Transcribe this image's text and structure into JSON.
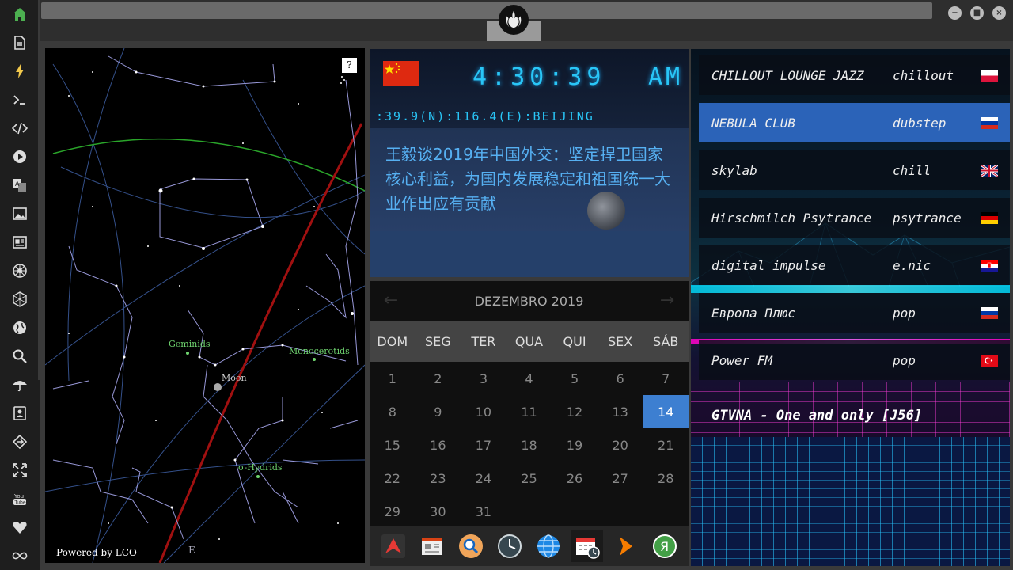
{
  "rail": {
    "items": [
      {
        "icon": "home-icon",
        "color": "#4caf50"
      },
      {
        "icon": "document-icon"
      },
      {
        "icon": "lightning-icon",
        "color": "#f2c94c"
      },
      {
        "icon": "terminal-icon"
      },
      {
        "icon": "code-icon"
      },
      {
        "icon": "play-icon"
      },
      {
        "icon": "translate-icon"
      },
      {
        "icon": "image-icon"
      },
      {
        "icon": "newspaper-icon"
      },
      {
        "icon": "rebel-icon"
      },
      {
        "icon": "hexagon-icon"
      },
      {
        "icon": "globe-icon"
      },
      {
        "icon": "search-icon"
      },
      {
        "icon": "umbrella-icon"
      },
      {
        "icon": "contact-icon"
      },
      {
        "icon": "swap-icon"
      },
      {
        "icon": "expand-icon"
      },
      {
        "icon": "youtube-icon",
        "label": "You Tube"
      },
      {
        "icon": "heart-icon"
      },
      {
        "icon": "infinity-icon"
      }
    ]
  },
  "topbar": {
    "emblem": "rebel-alliance-icon",
    "window_controls": [
      "minimize",
      "maximize",
      "close"
    ]
  },
  "starmap": {
    "help_label": "?",
    "powered_by": "Powered by LCO",
    "compass": "E",
    "labels": {
      "geminids": "Geminids",
      "monocerotids": "Monocerotids",
      "moon": "Moon",
      "hydrids": "σ-Hydrids"
    }
  },
  "clock": {
    "flag": "china-flag",
    "time": "4:30:39",
    "ampm": "AM",
    "coords": ":39.9(N):116.4(E):BEIJING",
    "headline": "王毅谈2019年中国外交：坚定捍卫国家核心利益，为国内发展稳定和祖国统一大业作出应有贡献"
  },
  "calendar": {
    "month_title": "DEZEMBRO 2019",
    "prev": "←",
    "next": "→",
    "weekdays": [
      "DOM",
      "SEG",
      "TER",
      "QUA",
      "QUI",
      "SEX",
      "SÁB"
    ],
    "days": [
      "1",
      "2",
      "3",
      "4",
      "5",
      "6",
      "7",
      "8",
      "9",
      "10",
      "11",
      "12",
      "13",
      "14",
      "15",
      "16",
      "17",
      "18",
      "19",
      "20",
      "21",
      "22",
      "23",
      "24",
      "25",
      "26",
      "27",
      "28",
      "29",
      "30",
      "31"
    ],
    "today": "14"
  },
  "dock": {
    "items": [
      "launcher-icon",
      "calendar-news-icon",
      "search-icon",
      "clock-icon",
      "globe-icon",
      "calendar-icon",
      "forward-icon",
      "yandex-icon"
    ]
  },
  "radio": {
    "stations": [
      {
        "name": "CHILLOUT LOUNGE JAZZ",
        "genre": "chillout",
        "flag": "poland-flag",
        "active": false
      },
      {
        "name": "NEBULA CLUB",
        "genre": "dubstep",
        "flag": "russia-flag",
        "active": true
      },
      {
        "name": "skylab",
        "genre": "chill",
        "flag": "uk-flag",
        "active": false
      },
      {
        "name": "Hirschmilch Psytrance",
        "genre": "psytrance",
        "flag": "germany-flag",
        "active": false
      },
      {
        "name": "digital impulse",
        "genre": "e.nic",
        "flag": "croatia-flag",
        "active": false
      },
      {
        "name": "Европа Плюс",
        "genre": "pop",
        "flag": "russia-flag",
        "active": false
      },
      {
        "name": "Power FM",
        "genre": "pop",
        "flag": "turkey-flag",
        "active": false
      }
    ],
    "now_playing": "GTVNA - One and only [J56]"
  }
}
